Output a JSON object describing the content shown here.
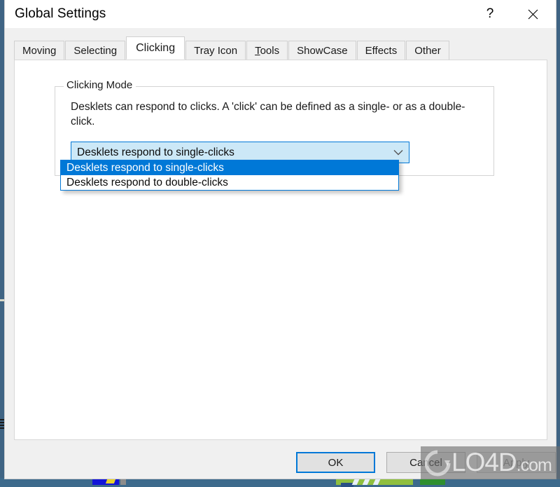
{
  "window": {
    "title": "Global Settings",
    "help_icon": "question-mark-icon",
    "close_icon": "close-x-icon"
  },
  "tabs": [
    {
      "label": "Moving",
      "active": false,
      "accel": ""
    },
    {
      "label": "Selecting",
      "active": false,
      "accel": ""
    },
    {
      "label": "Clicking",
      "active": true,
      "accel": ""
    },
    {
      "label": "Tray Icon",
      "active": false,
      "accel": ""
    },
    {
      "label": "Tools",
      "active": false,
      "accel": "T"
    },
    {
      "label": "ShowCase",
      "active": false,
      "accel": ""
    },
    {
      "label": "Effects",
      "active": false,
      "accel": ""
    },
    {
      "label": "Other",
      "active": false,
      "accel": ""
    }
  ],
  "group": {
    "label": "Clicking Mode",
    "description": "Desklets can respond to clicks. A 'click' can be defined as a single- or as a double-click."
  },
  "combo": {
    "value": "Desklets respond to single-clicks",
    "arrow_icon": "chevron-down-icon",
    "open": true,
    "options": [
      {
        "label": "Desklets respond to single-clicks",
        "selected": true
      },
      {
        "label": "Desklets respond to double-clicks",
        "selected": false
      }
    ]
  },
  "buttons": {
    "ok": "OK",
    "cancel": "Cancel",
    "apply": "Apply",
    "apply_enabled": false
  },
  "watermark": {
    "text": "LO4D",
    "suffix": ".com"
  },
  "colors": {
    "accent": "#0078D7",
    "combo_fill": "#CCE8F7",
    "dialog_bg": "#F0F0F0",
    "panel_bg": "#FFFFFF",
    "desktop_bg": "#3F6484",
    "disabled_text": "#8D8D8D"
  }
}
